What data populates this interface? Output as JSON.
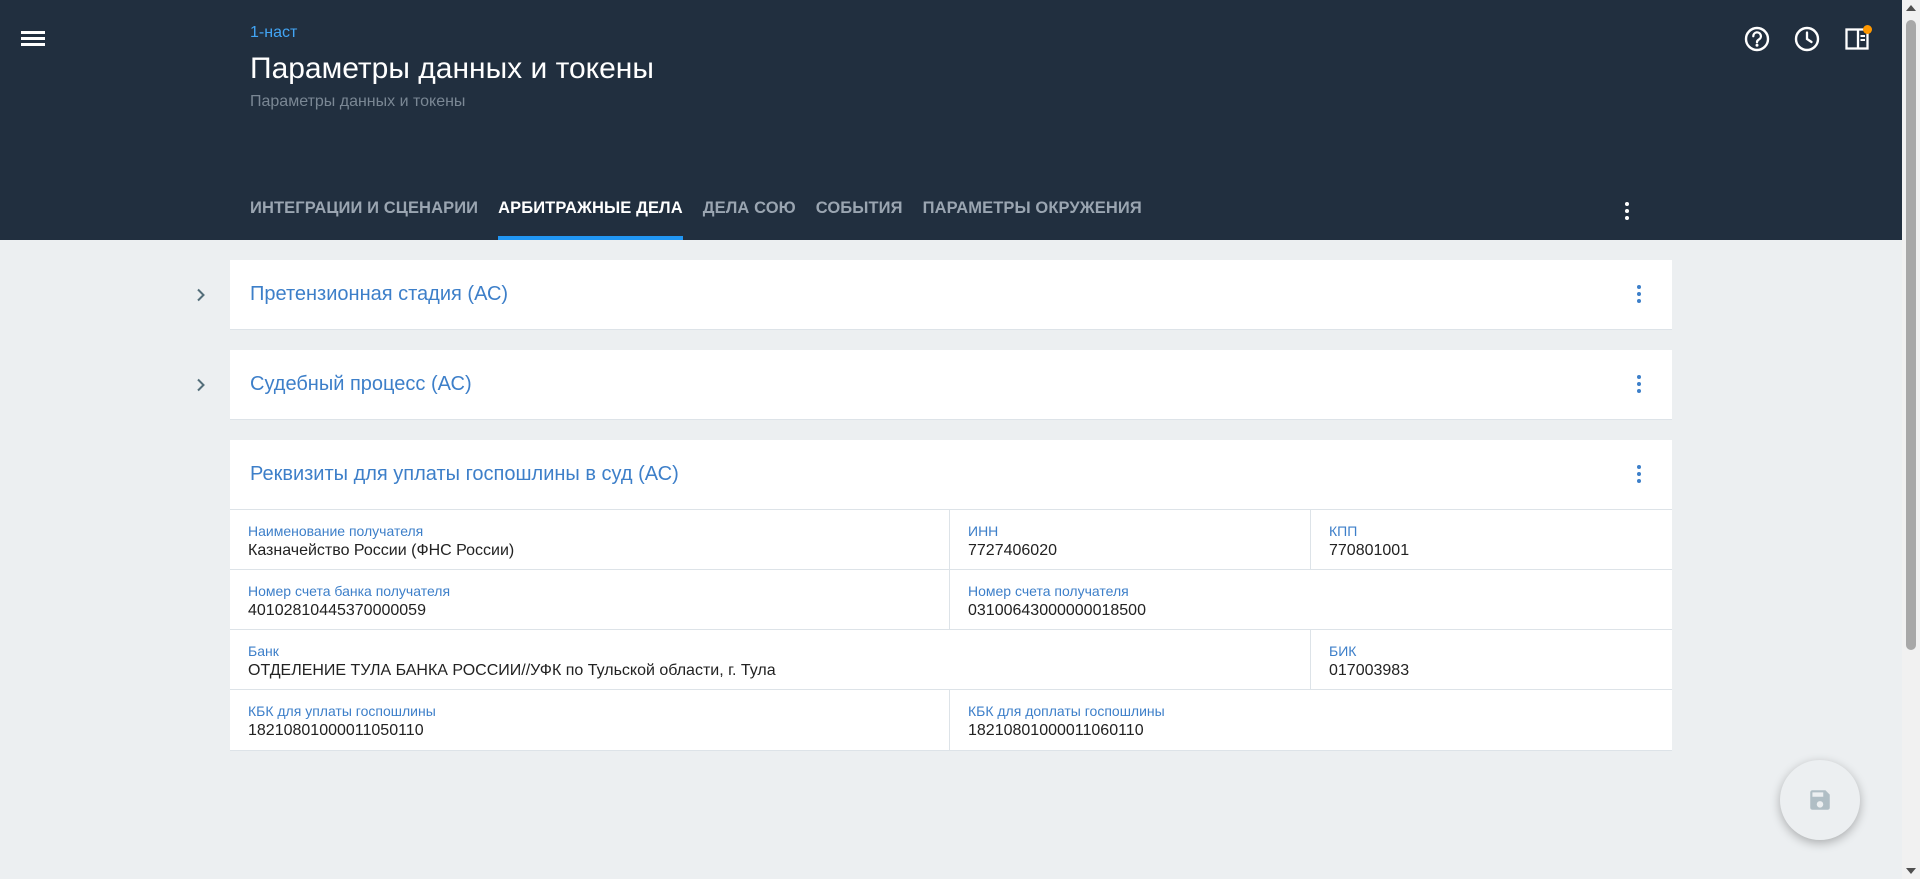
{
  "header": {
    "breadcrumb": "1-наст",
    "title": "Параметры данных и токены",
    "subtitle": "Параметры данных и токены",
    "icons": [
      "help-icon",
      "history-icon",
      "panel-icon"
    ],
    "badge_color": "#ff9800"
  },
  "tabs": [
    {
      "label": "ИНТЕГРАЦИИ И СЦЕНАРИИ",
      "active": false
    },
    {
      "label": "АРБИТРАЖНЫЕ ДЕЛА",
      "active": true
    },
    {
      "label": "ДЕЛА СОЮ",
      "active": false
    },
    {
      "label": "СОБЫТИЯ",
      "active": false
    },
    {
      "label": "ПАРАМЕТРЫ ОКРУЖЕНИЯ",
      "active": false
    }
  ],
  "panels": [
    {
      "title": "Претензионная стадия (АС)",
      "expanded": false
    },
    {
      "title": "Судебный процесс (АС)",
      "expanded": false
    },
    {
      "title": "Реквизиты для уплаты госпошлины в суд (АС)",
      "expanded": true,
      "fields": {
        "recipient_name": {
          "label": "Наименование получателя",
          "value": "Казначейство России (ФНС России)"
        },
        "inn": {
          "label": "ИНН",
          "value": "7727406020"
        },
        "kpp": {
          "label": "КПП",
          "value": "770801001"
        },
        "bank_account": {
          "label": "Номер счета банка получателя",
          "value": "40102810445370000059"
        },
        "recipient_account": {
          "label": "Номер счета получателя",
          "value": "03100643000000018500"
        },
        "bank": {
          "label": "Банк",
          "value": "ОТДЕЛЕНИЕ ТУЛА БАНКА РОССИИ//УФК по Тульской области, г. Тула"
        },
        "bik": {
          "label": "БИК",
          "value": "017003983"
        },
        "kbk_pay": {
          "label": "КБК для уплаты госпошлины",
          "value": "18210801000011050110"
        },
        "kbk_extra": {
          "label": "КБК для доплаты госпошлины",
          "value": "18210801000011060110"
        }
      }
    }
  ],
  "colors": {
    "header_bg": "#212f3f",
    "accent": "#2196f3",
    "link": "#3d7fc9",
    "page_bg": "#eceff1"
  }
}
